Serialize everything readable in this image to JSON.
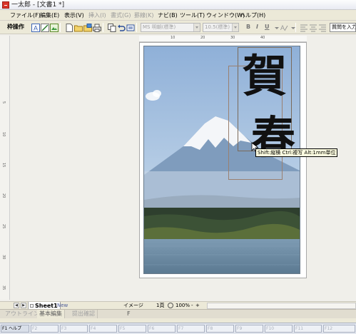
{
  "window": {
    "title": "一太郎 - [文書1 *]"
  },
  "menu": [
    {
      "label": "ファイル(F)",
      "enabled": true
    },
    {
      "label": "編集(E)",
      "enabled": true
    },
    {
      "label": "表示(V)",
      "enabled": true
    },
    {
      "label": "挿入(I)",
      "enabled": false
    },
    {
      "label": "書式(G)",
      "enabled": false
    },
    {
      "label": "罫線(K)",
      "enabled": false
    },
    {
      "label": "ナビ(B)",
      "enabled": true
    },
    {
      "label": "ツール(T)",
      "enabled": true
    },
    {
      "label": "ウィンドウ(W)",
      "enabled": true
    },
    {
      "label": "ヘルプ(H)",
      "enabled": true
    }
  ],
  "toolbar": {
    "mode_label": "枠操作",
    "font_name": "MS 明朝(標準)",
    "font_size": "10.5(標準)",
    "bold": "B",
    "italic": "I",
    "underline": "U",
    "question_placeholder": "質問を入力"
  },
  "rulers": {
    "top": [
      "10",
      "20",
      "30",
      "40"
    ],
    "left": [
      "5",
      "10",
      "15",
      "20",
      "25",
      "30",
      "35"
    ]
  },
  "document": {
    "calligraphy_text": "賀春",
    "tooltip": "Shift:縦横 Ctrl:複写 Alt:1mm単位"
  },
  "statusbar": {
    "sheet_name": "Sheet1",
    "new_label": "New",
    "image_label": "イメージ",
    "page_label": "1頁",
    "zoom": "100%",
    "zoom_minus": "-",
    "zoom_plus": "+"
  },
  "bottom_tabs": [
    {
      "label": "アウトライン",
      "active": false
    },
    {
      "label": "基本編集",
      "active": true
    },
    {
      "label": "提出確認",
      "active": false
    }
  ],
  "bottom_extra": "F",
  "fkeys": [
    "F1 ヘルプ",
    "F2",
    "F3",
    "F4",
    "F5",
    "F6",
    "F7",
    "F8",
    "F9",
    "F10",
    "F11",
    "F12"
  ],
  "colors": {
    "sky": "#a8c4e2",
    "lake": "#6f8fa8",
    "tooltip_bg": "#ffffe1",
    "frame": "#7a6a5a"
  }
}
